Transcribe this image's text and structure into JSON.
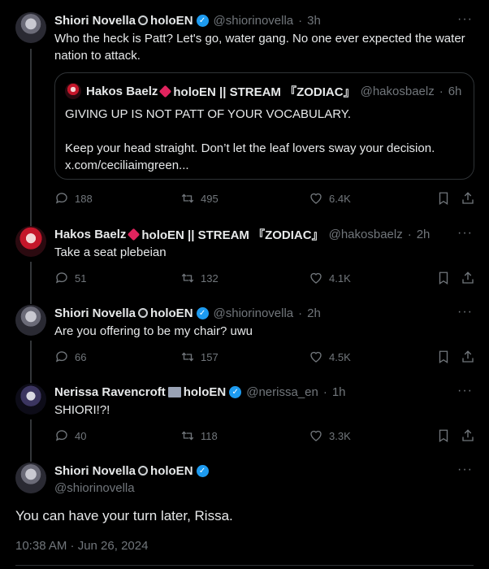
{
  "tweets": [
    {
      "name": "Shiori Novella",
      "brand": "holoEN",
      "handle": "@shiorinovella",
      "time": "3h",
      "text_line1": "Who the heck is Patt? Let's go, water gang. No one ever expected the water",
      "text_line2": "nation to attack.",
      "quote": {
        "name": "Hakos Baelz",
        "brand": "holoEN || STREAM 『ZODIAC』",
        "handle": "@hakosbaelz",
        "time": "6h",
        "line1": "GIVING UP IS NOT PATT OF YOUR VOCABULARY.",
        "line2": "Keep your head straight. Don’t let the leaf lovers sway your decision.",
        "line3": "x.com/ceciliaimgreen..."
      },
      "replies": "188",
      "reposts": "495",
      "likes": "6.4K"
    },
    {
      "name": "Hakos Baelz",
      "brand": "holoEN || STREAM 『ZODIAC』",
      "handle": "@hakosbaelz",
      "time": "2h",
      "text": "Take a seat plebeian",
      "replies": "51",
      "reposts": "132",
      "likes": "4.1K"
    },
    {
      "name": "Shiori Novella",
      "brand": "holoEN",
      "handle": "@shiorinovella",
      "time": "2h",
      "text": "Are you offering to be my chair? uwu",
      "replies": "66",
      "reposts": "157",
      "likes": "4.5K"
    },
    {
      "name": "Nerissa Ravencroft",
      "brand": "holoEN",
      "handle": "@nerissa_en",
      "time": "1h",
      "text": "SHIORI!?!",
      "replies": "40",
      "reposts": "118",
      "likes": "3.3K"
    }
  ],
  "main": {
    "name": "Shiori Novella",
    "brand": "holoEN",
    "handle": "@shiorinovella",
    "text": "You can have your turn later, Rissa.",
    "timestamp": "10:38 AM · Jun 26, 2024"
  },
  "separator": "·",
  "more_label": "···",
  "colors": {
    "background": "#000000",
    "text": "#e7e9ea",
    "muted": "#71767b",
    "verified": "#1d9bf0",
    "line": "#333639"
  }
}
